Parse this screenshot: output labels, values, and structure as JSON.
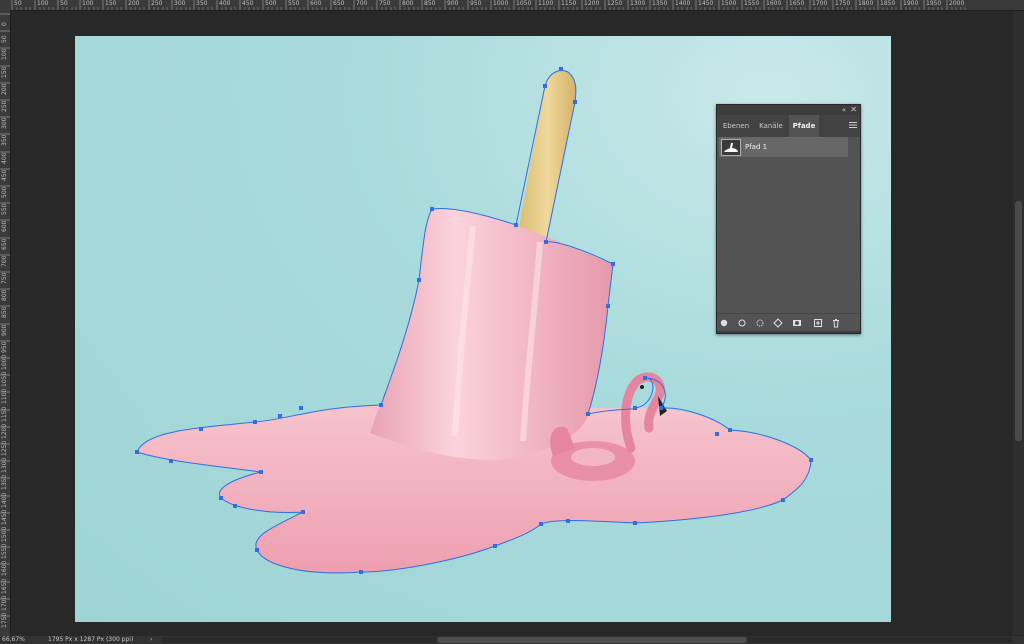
{
  "ruler": {
    "h_labels": [
      "50",
      "100",
      "50",
      "100",
      "150",
      "200",
      "250",
      "300",
      "350",
      "400",
      "450",
      "500",
      "550",
      "600",
      "650",
      "700",
      "750",
      "800",
      "850",
      "900",
      "950",
      "1000",
      "1050",
      "1100",
      "1150",
      "1200",
      "1250",
      "1300",
      "1350",
      "1400",
      "1450",
      "1500",
      "1550",
      "1600",
      "1650",
      "1700",
      "1750",
      "1800",
      "1850",
      "1900",
      "1950",
      "2000"
    ],
    "v_labels": [
      "0",
      "50",
      "100",
      "150",
      "200",
      "250",
      "300",
      "350",
      "400",
      "450",
      "500",
      "550",
      "600",
      "650",
      "700",
      "750",
      "800",
      "850",
      "900",
      "950",
      "1000",
      "1050",
      "1100",
      "1150",
      "1200",
      "1250",
      "1300",
      "1350",
      "1400",
      "1450",
      "1500",
      "1550",
      "1600",
      "1650",
      "1700",
      "1750"
    ]
  },
  "status": {
    "zoom": "66,67%",
    "doc_size": "1795 Px x 1287 Px (300 ppi)",
    "arrow": "›"
  },
  "paths_panel": {
    "collapse_icon": "«",
    "close_icon": "✕",
    "tabs": [
      {
        "label": "Ebenen",
        "active": false
      },
      {
        "label": "Kanäle",
        "active": false
      },
      {
        "label": "Pfade",
        "active": true
      }
    ],
    "path_items": [
      {
        "name": "Pfad 1"
      }
    ],
    "footer_icons": [
      "fill-path-icon",
      "stroke-path-icon",
      "load-selection-icon",
      "make-path-icon",
      "add-mask-icon",
      "new-path-icon",
      "delete-path-icon"
    ]
  },
  "colors": {
    "background": "#9fd4d5",
    "popsicle": "#f3b6c2",
    "stick": "#e9cf8c",
    "path_stroke": "#2f6fe0",
    "anchor": "#2f6fe0"
  }
}
